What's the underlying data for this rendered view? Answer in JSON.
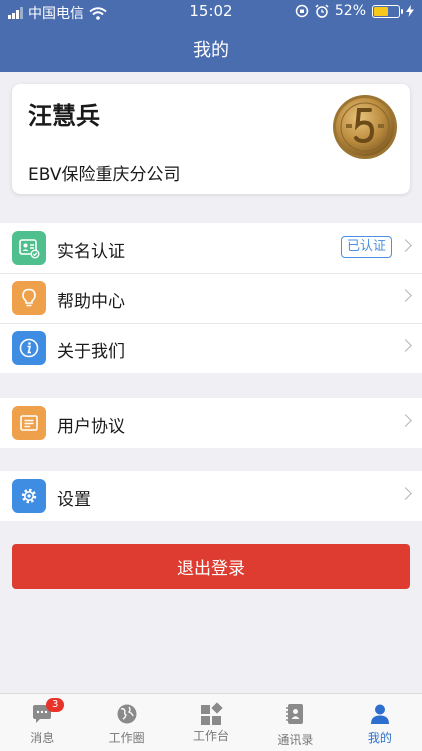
{
  "status_bar": {
    "carrier": "中国电信",
    "time": "15:02",
    "battery": "52%",
    "battery_level": 0.52
  },
  "nav": {
    "title": "我的"
  },
  "profile": {
    "name": "汪慧兵",
    "company": "EBV保险重庆分公司",
    "avatar_icon": "coin-avatar"
  },
  "menu": {
    "group1": [
      {
        "label": "实名认证",
        "icon": "id-card-icon",
        "color": "#4fc08d",
        "badge": "已认证"
      },
      {
        "label": "帮助中心",
        "icon": "lightbulb-icon",
        "color": "#efa04b"
      },
      {
        "label": "关于我们",
        "icon": "info-icon",
        "color": "#3f8de3"
      }
    ],
    "group2": [
      {
        "label": "用户协议",
        "icon": "document-icon",
        "color": "#efa04b"
      }
    ],
    "group3": [
      {
        "label": "设置",
        "icon": "gear-icon",
        "color": "#3f8de3"
      }
    ]
  },
  "logout_label": "退出登录",
  "colors": {
    "header": "#4a6db0",
    "logout": "#de3b31",
    "active_tab": "#2d6fce",
    "verified_badge": "#4a8fe0"
  },
  "tabs": [
    {
      "label": "消息",
      "icon": "chat-icon",
      "badge": "3"
    },
    {
      "label": "工作圈",
      "icon": "globe-icon"
    },
    {
      "label": "工作台",
      "icon": "dashboard-icon"
    },
    {
      "label": "通讯录",
      "icon": "contacts-icon"
    },
    {
      "label": "我的",
      "icon": "person-icon",
      "active": true
    }
  ]
}
